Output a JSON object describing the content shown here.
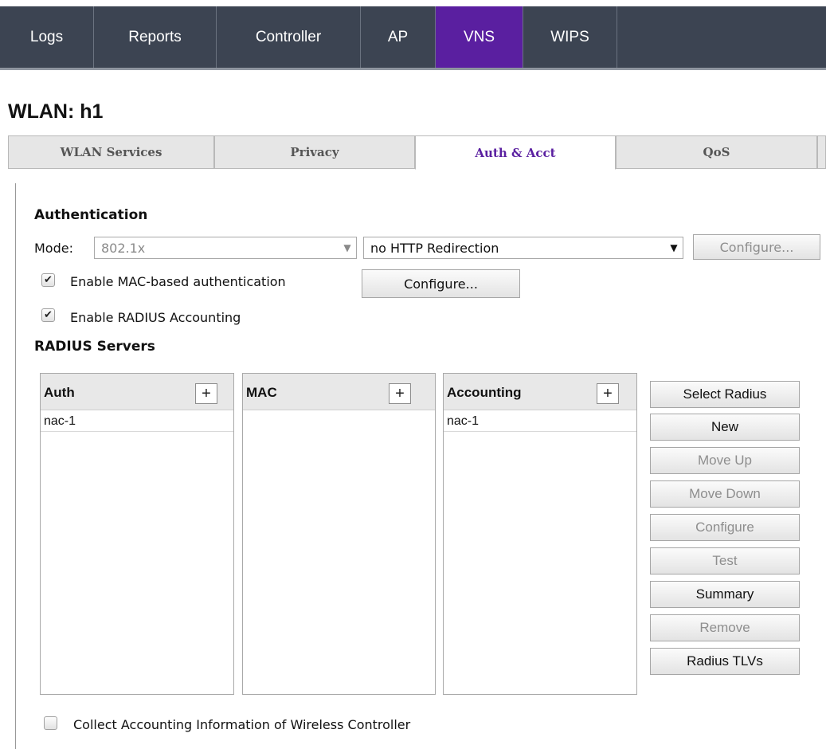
{
  "topnav": {
    "tabs": [
      {
        "label": "Logs"
      },
      {
        "label": "Reports"
      },
      {
        "label": "Controller"
      },
      {
        "label": "AP"
      },
      {
        "label": "VNS"
      },
      {
        "label": "WIPS"
      }
    ],
    "active": "VNS"
  },
  "page": {
    "title": "WLAN: h1"
  },
  "subtabs": {
    "tabs": [
      {
        "label": "WLAN Services"
      },
      {
        "label": "Privacy"
      },
      {
        "label": "Auth & Acct"
      },
      {
        "label": "QoS"
      }
    ],
    "active": "Auth & Acct"
  },
  "authentication": {
    "heading": "Authentication",
    "mode_label": "Mode:",
    "mode_value": "802.1x",
    "redirect_value": "no HTTP Redirection",
    "configure_label": "Configure...",
    "mac_auth": {
      "label": "Enable MAC-based authentication",
      "checked": true
    },
    "mac_configure_label": "Configure...",
    "radius_accounting": {
      "label": "Enable RADIUS Accounting",
      "checked": true
    }
  },
  "radius": {
    "heading": "RADIUS Servers",
    "panels": {
      "auth": {
        "title": "Auth",
        "items": [
          "nac-1"
        ]
      },
      "mac": {
        "title": "MAC",
        "items": []
      },
      "accounting": {
        "title": "Accounting",
        "items": [
          "nac-1"
        ]
      }
    },
    "plus_label": "+",
    "buttons": {
      "select_radius": "Select Radius",
      "new": "New",
      "move_up": "Move Up",
      "move_down": "Move Down",
      "configure": "Configure",
      "test": "Test",
      "summary": "Summary",
      "remove": "Remove",
      "radius_tlvs": "Radius TLVs"
    }
  },
  "collect_accounting": {
    "label": "Collect Accounting Information of Wireless Controller",
    "checked": false
  },
  "icons": {
    "dropdown_arrow": "▼",
    "checkmark": "✔"
  },
  "colors": {
    "nav_bg": "#3c4452",
    "accent": "#5a1fa0"
  }
}
